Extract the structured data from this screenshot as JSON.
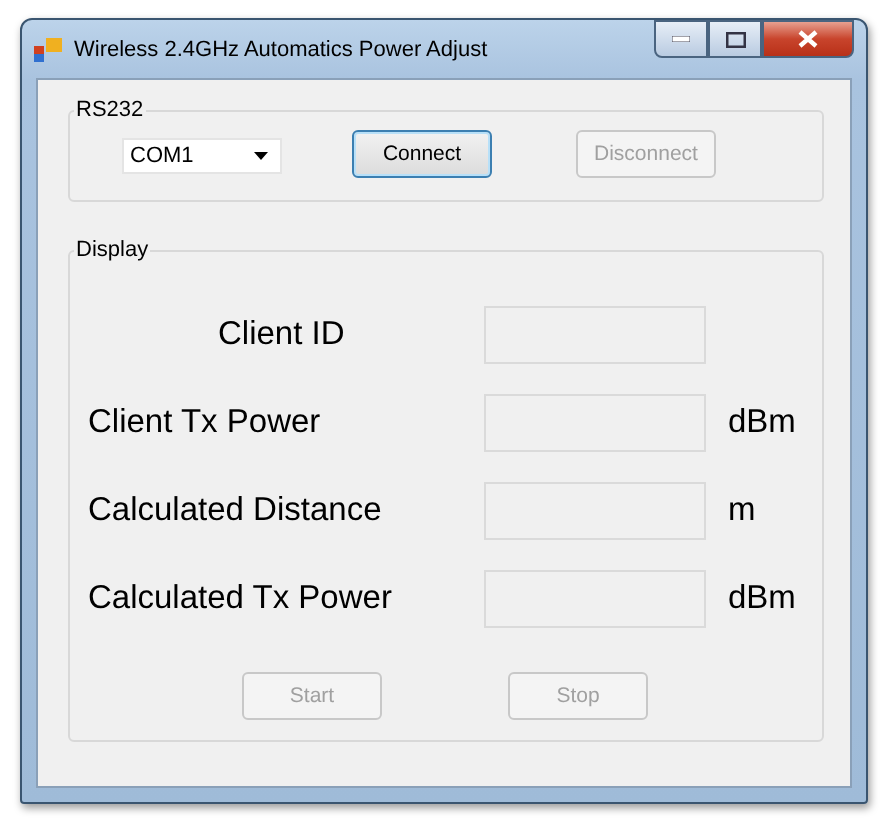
{
  "window": {
    "title": "Wireless 2.4GHz Automatics Power Adjust"
  },
  "rs232": {
    "title": "RS232",
    "port": {
      "value": "COM1"
    },
    "buttons": [
      {
        "label": "Connect",
        "disabled": false,
        "focused": true
      },
      {
        "label": "Disconnect",
        "disabled": true,
        "focused": false
      }
    ]
  },
  "display": {
    "title": "Display",
    "rows": [
      {
        "label": "Client ID"
      },
      {
        "label": "Client Tx Power",
        "unit": "dBm"
      },
      {
        "label": "Calculated Distance",
        "unit": "m"
      },
      {
        "label": "Calculated Tx Power",
        "unit": "dBm"
      }
    ],
    "buttons": [
      {
        "label": "Start",
        "disabled": true
      },
      {
        "label": "Stop",
        "disabled": true
      }
    ]
  }
}
